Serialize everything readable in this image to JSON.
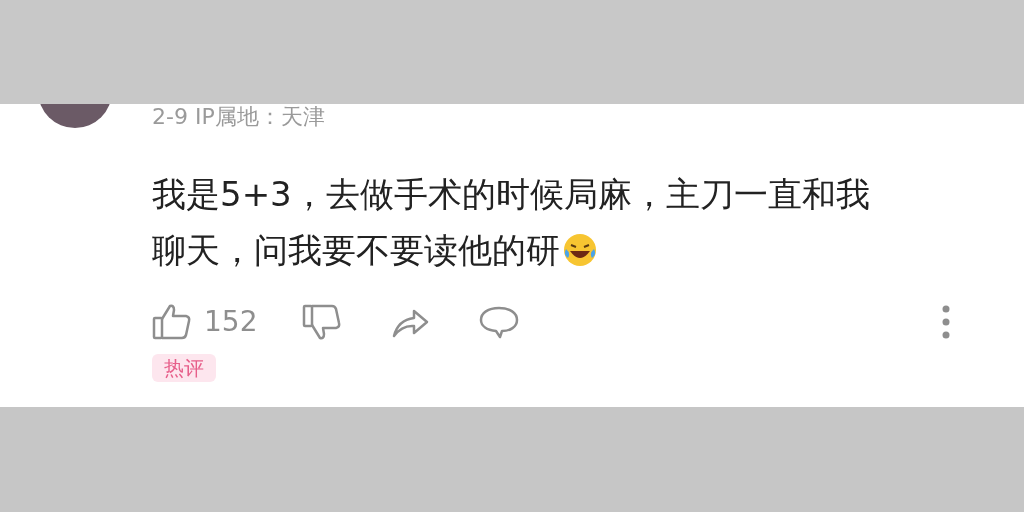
{
  "comment": {
    "meta": "2-9 IP属地：天津",
    "lines": [
      "我是5+3，去做手术的时候局麻，主刀一直和我",
      "聊天，问我要不要读他的研"
    ],
    "likes": "152",
    "tag": "热评"
  }
}
